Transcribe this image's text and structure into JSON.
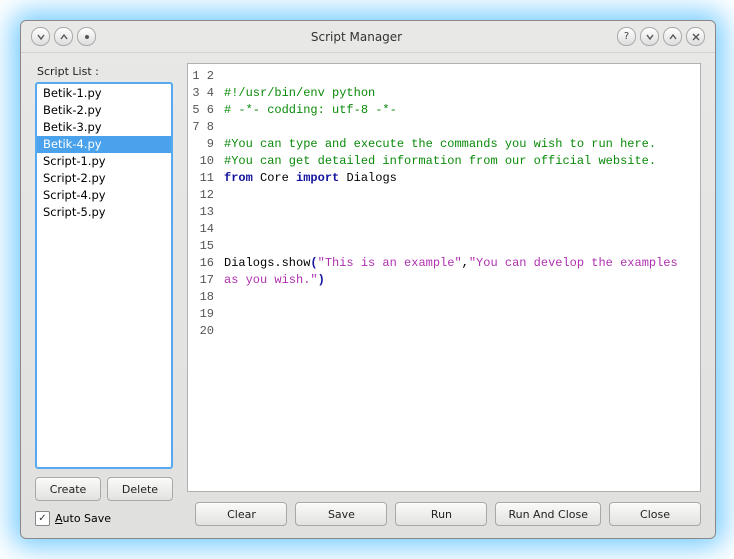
{
  "window": {
    "title": "Script Manager"
  },
  "titlebar": {
    "left_icons": [
      "down-icon",
      "up-icon",
      "pin-icon"
    ],
    "right_icons": [
      "help-icon",
      "minimize-icon",
      "maximize-icon",
      "close-icon"
    ]
  },
  "sidebar": {
    "label": "Script List :",
    "items": [
      {
        "name": "Betik-1.py",
        "selected": false
      },
      {
        "name": "Betik-2.py",
        "selected": false
      },
      {
        "name": "Betik-3.py",
        "selected": false
      },
      {
        "name": "Betik-4.py",
        "selected": true
      },
      {
        "name": "Script-1.py",
        "selected": false
      },
      {
        "name": "Script-2.py",
        "selected": false
      },
      {
        "name": "Script-4.py",
        "selected": false
      },
      {
        "name": "Script-5.py",
        "selected": false
      }
    ],
    "buttons": {
      "create": "Create",
      "delete": "Delete"
    },
    "autosave": {
      "label": "Auto Save",
      "checked": true
    }
  },
  "editor": {
    "line_count": 20,
    "lines": {
      "l1": "#!/usr/bin/env python",
      "l2": "# -*- codding: utf-8 -*-",
      "l4": "#You can type and execute the commands you wish to run here.",
      "l5": "#You can get detailed information from our official website.",
      "l6a": "from",
      "l6b": " Core ",
      "l6c": "import",
      "l6d": " Dialogs",
      "l11a": "Dialogs.show",
      "l11b": "(",
      "l11c": "\"This is an example\"",
      "l11d": ",",
      "l11e": "\"You can develop the examples as you wish.\"",
      "l11f": ")"
    }
  },
  "footer": {
    "clear": "Clear",
    "save": "Save",
    "run": "Run",
    "run_and_close": "Run And Close",
    "close": "Close"
  }
}
